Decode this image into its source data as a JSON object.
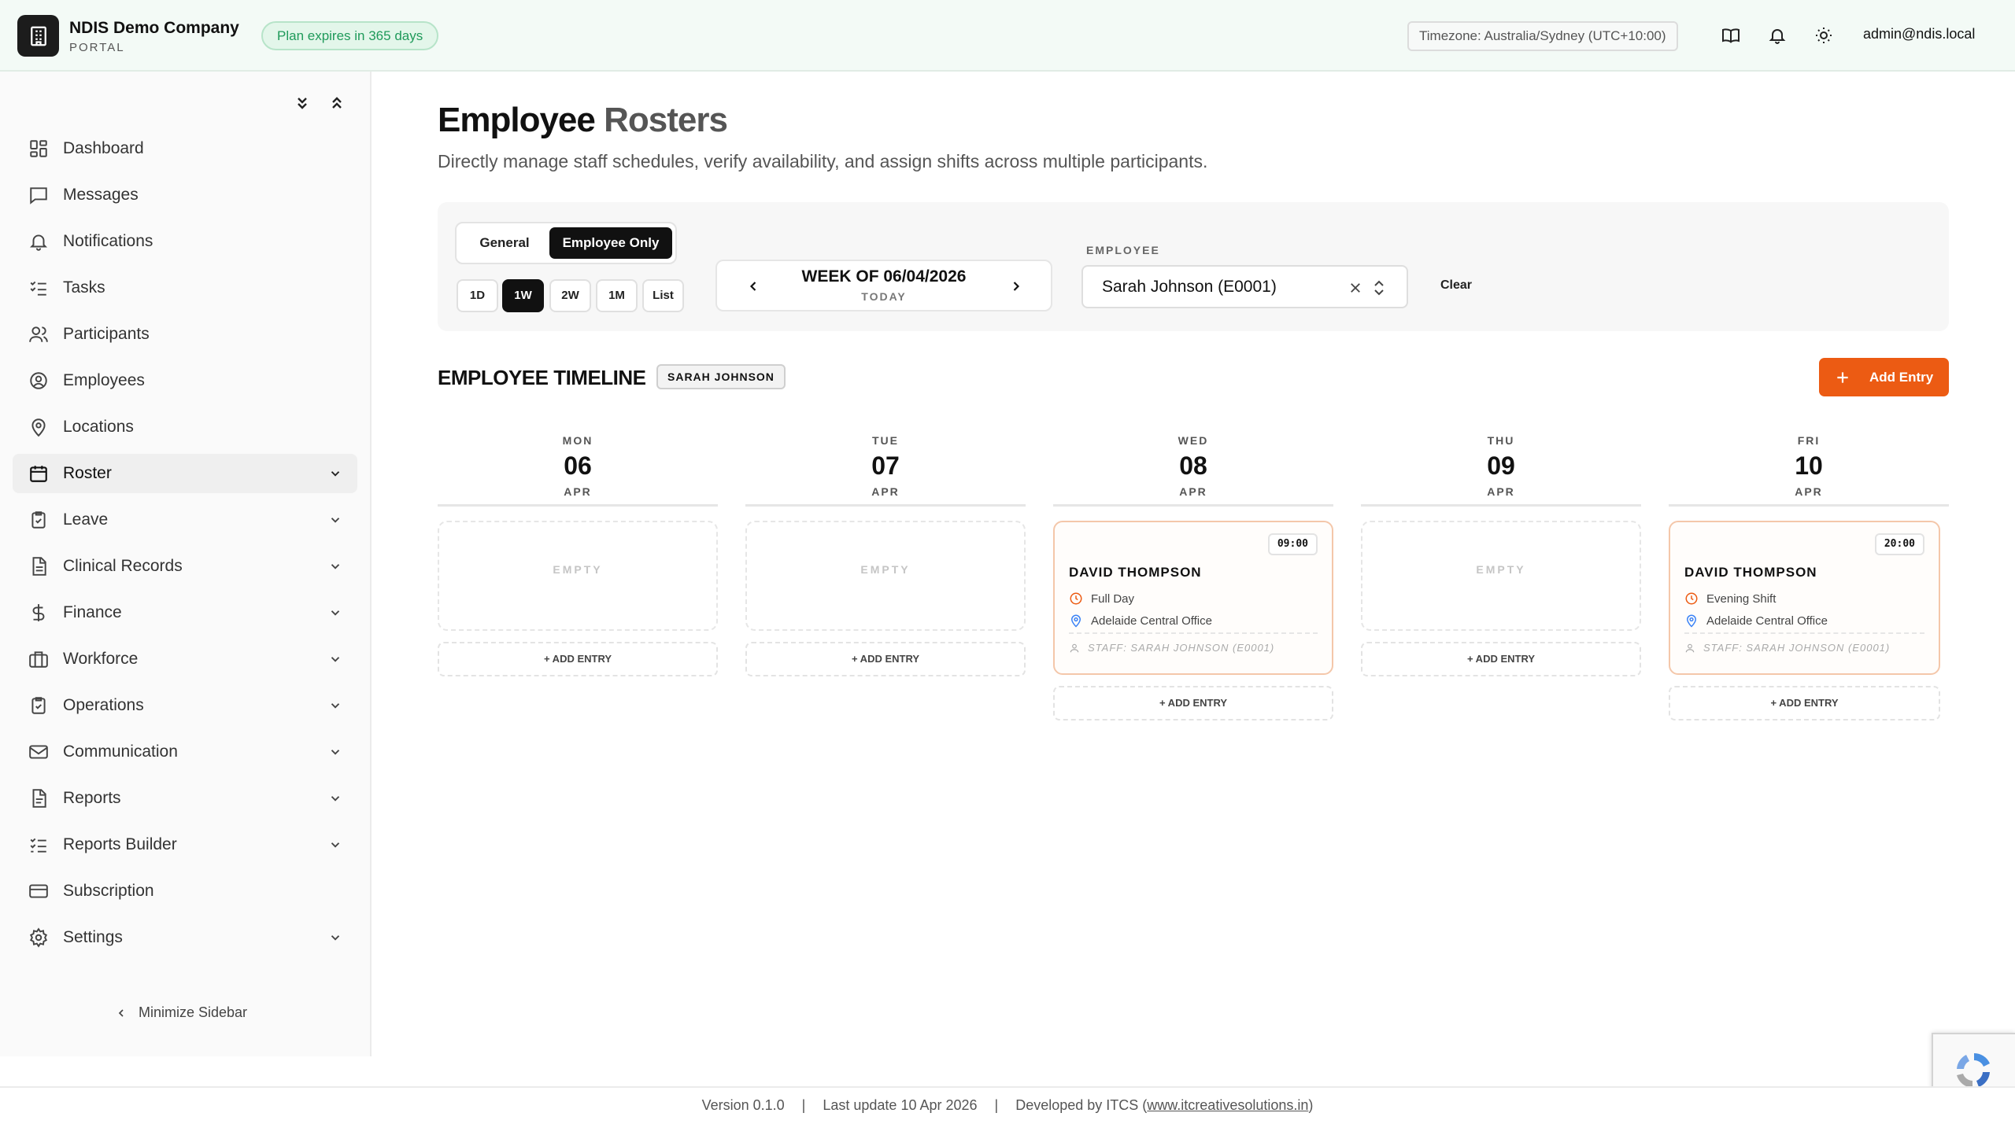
{
  "header": {
    "company": "NDIS Demo Company",
    "portal": "PORTAL",
    "plan": "Plan expires in 365 days",
    "timezone": "Timezone: Australia/Sydney (UTC+10:00)",
    "user": "admin@ndis.local"
  },
  "sidebar": {
    "items": [
      {
        "label": "Dashboard",
        "icon": "dashboard-icon"
      },
      {
        "label": "Messages",
        "icon": "message-icon"
      },
      {
        "label": "Notifications",
        "icon": "bell-icon"
      },
      {
        "label": "Tasks",
        "icon": "checklist-icon"
      },
      {
        "label": "Participants",
        "icon": "users-icon"
      },
      {
        "label": "Employees",
        "icon": "user-circle-icon"
      },
      {
        "label": "Locations",
        "icon": "map-pin-icon"
      },
      {
        "label": "Roster",
        "icon": "calendar-icon"
      },
      {
        "label": "Leave",
        "icon": "clipboard-check-icon"
      },
      {
        "label": "Clinical Records",
        "icon": "file-text-icon"
      },
      {
        "label": "Finance",
        "icon": "dollar-icon"
      },
      {
        "label": "Workforce",
        "icon": "briefcase-icon"
      },
      {
        "label": "Operations",
        "icon": "clipboard-icon"
      },
      {
        "label": "Communication",
        "icon": "mail-icon"
      },
      {
        "label": "Reports",
        "icon": "report-icon"
      },
      {
        "label": "Reports Builder",
        "icon": "list-check-icon"
      },
      {
        "label": "Subscription",
        "icon": "credit-card-icon"
      },
      {
        "label": "Settings",
        "icon": "gear-icon"
      }
    ],
    "minimize": "Minimize Sidebar"
  },
  "page": {
    "title_main": "Employee ",
    "title_accent": "Rosters",
    "subtitle": "Directly manage staff schedules, verify availability, and assign shifts across multiple participants."
  },
  "filters": {
    "modes": [
      "General",
      "Employee Only"
    ],
    "ranges": [
      "1D",
      "1W",
      "2W",
      "1M",
      "List"
    ],
    "week_title": "WEEK OF 06/04/2026",
    "week_sub": "TODAY",
    "employee_label": "EMPLOYEE",
    "employee_value": "Sarah Johnson (E0001)",
    "clear": "Clear"
  },
  "timeline": {
    "title": "EMPLOYEE TIMELINE",
    "badge": "SARAH JOHNSON",
    "add_button": "Add Entry",
    "empty_label": "EMPTY",
    "add_row_label": "+ ADD ENTRY",
    "days": [
      {
        "dow": "MON",
        "num": "06",
        "mon": "APR"
      },
      {
        "dow": "TUE",
        "num": "07",
        "mon": "APR"
      },
      {
        "dow": "WED",
        "num": "08",
        "mon": "APR",
        "shift": {
          "time": "09:00",
          "name": "DAVID THOMPSON",
          "type": "Full Day",
          "location": "Adelaide Central Office",
          "staff": "STAFF: SARAH JOHNSON (E0001)"
        }
      },
      {
        "dow": "THU",
        "num": "09",
        "mon": "APR"
      },
      {
        "dow": "FRI",
        "num": "10",
        "mon": "APR",
        "shift": {
          "time": "20:00",
          "name": "DAVID THOMPSON",
          "type": "Evening Shift",
          "location": "Adelaide Central Office",
          "staff": "STAFF: SARAH JOHNSON (E0001)"
        }
      }
    ]
  },
  "footer": {
    "version": "Version 0.1.0",
    "updated": "Last update 10 Apr 2026",
    "dev_prefix": "Developed by ITCS (",
    "dev_link": "www.itcreativesolutions.in",
    "dev_suffix": ")"
  }
}
